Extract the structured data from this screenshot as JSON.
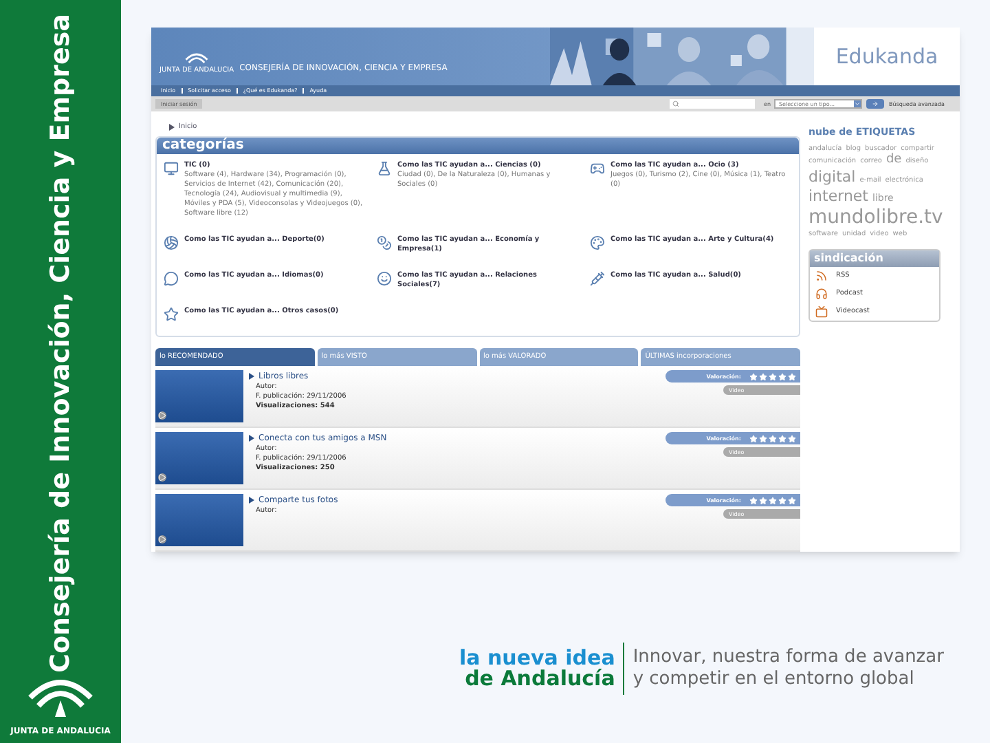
{
  "sidebar": {
    "title": "Consejería de Innovación, Ciencia y Empresa",
    "logo_text": "JUNTA DE ANDALUCIA"
  },
  "site": {
    "header": {
      "org_logo_text": "JUNTA DE ANDALUCIA",
      "title": "CONSEJERÍA DE INNOVACIÓN, CIENCIA Y EMPRESA",
      "brand": "Edukanda"
    },
    "nav": [
      "Inicio",
      "Solicitar acceso",
      "¿Qué es Edukanda?",
      "Ayuda"
    ],
    "login_button": "Iniciar sesión",
    "search": {
      "in_label": "en",
      "type_select": "Seleccione un tipo...",
      "advanced_link": "Búsqueda avanzada"
    },
    "breadcrumb": "Inicio",
    "categories": {
      "title": "categorías",
      "items": [
        {
          "title": "TIC (0)",
          "subtitle": "Software (4), Hardware (34), Programación (0), Servicios de Internet (42), Comunicación (20), Tecnología (24), Audiovisual y multimedia (9), Móviles y PDA (5), Videoconsolas y Videojuegos (0), Software libre (12)"
        },
        {
          "title": "Como las TIC ayudan a... Ciencias (0)",
          "subtitle": "Ciudad (0), De la Naturaleza (0), Humanas y Sociales (0)"
        },
        {
          "title": "Como las TIC ayudan a... Ocio (3)",
          "subtitle": "Juegos (0), Turismo (2), Cine (0), Música (1), Teatro (0)"
        },
        {
          "title": "Como las TIC ayudan a... Deporte(0)"
        },
        {
          "title": "Como las TIC ayudan a... Economía y Empresa(1)"
        },
        {
          "title": "Como las TIC ayudan a... Arte y Cultura(4)"
        },
        {
          "title": "Como las TIC ayudan a... Idiomas(0)"
        },
        {
          "title": "Como las TIC ayudan a... Relaciones Sociales(7)"
        },
        {
          "title": "Como las TIC ayudan a... Salud(0)"
        },
        {
          "title": "Como las TIC ayudan a... Otros casos(0)"
        }
      ]
    },
    "tag_cloud": {
      "title": "nube de ETIQUETAS",
      "tags": [
        "andalucía",
        "blog",
        "buscador",
        "compartir",
        "comunicación",
        "correo",
        "de",
        "diseño",
        "digital",
        "e-mail",
        "electrónica",
        "internet",
        "libre",
        "mundolibre.tv",
        "software",
        "unidad",
        "video",
        "web"
      ]
    },
    "syndication": {
      "title": "sindicación",
      "items": [
        "RSS",
        "Podcast",
        "Videocast"
      ]
    },
    "tabs": [
      {
        "label": "lo RECOMENDADO",
        "selected": true
      },
      {
        "label": "lo más VISTO",
        "selected": false
      },
      {
        "label": "lo más VALORADO",
        "selected": false
      },
      {
        "label": "ÚLTIMAS incorporaciones",
        "selected": false
      }
    ],
    "items": [
      {
        "title": "Libros libres",
        "author": "Autor:",
        "date": "F. publicación: 29/11/2006",
        "views": "Visualizaciones: 544",
        "rating_label": "Valoración:",
        "stars": 5,
        "type": "Video"
      },
      {
        "title": "Conecta con tus amigos a MSN",
        "author": "Autor:",
        "date": "F. publicación: 29/11/2006",
        "views": "Visualizaciones: 250",
        "rating_label": "Valoración:",
        "stars": 5,
        "type": "Video"
      },
      {
        "title": "Comparte tus fotos",
        "author": "Autor:",
        "rating_label": "Valoración:",
        "stars": 5,
        "type": "Video"
      }
    ]
  },
  "footer": {
    "slogan_line1": "la nueva idea",
    "slogan_line2": "de Andalucía",
    "tagline_line1": "Innovar, nuestra forma de avanzar",
    "tagline_line2": "y competir en el entorno global"
  }
}
